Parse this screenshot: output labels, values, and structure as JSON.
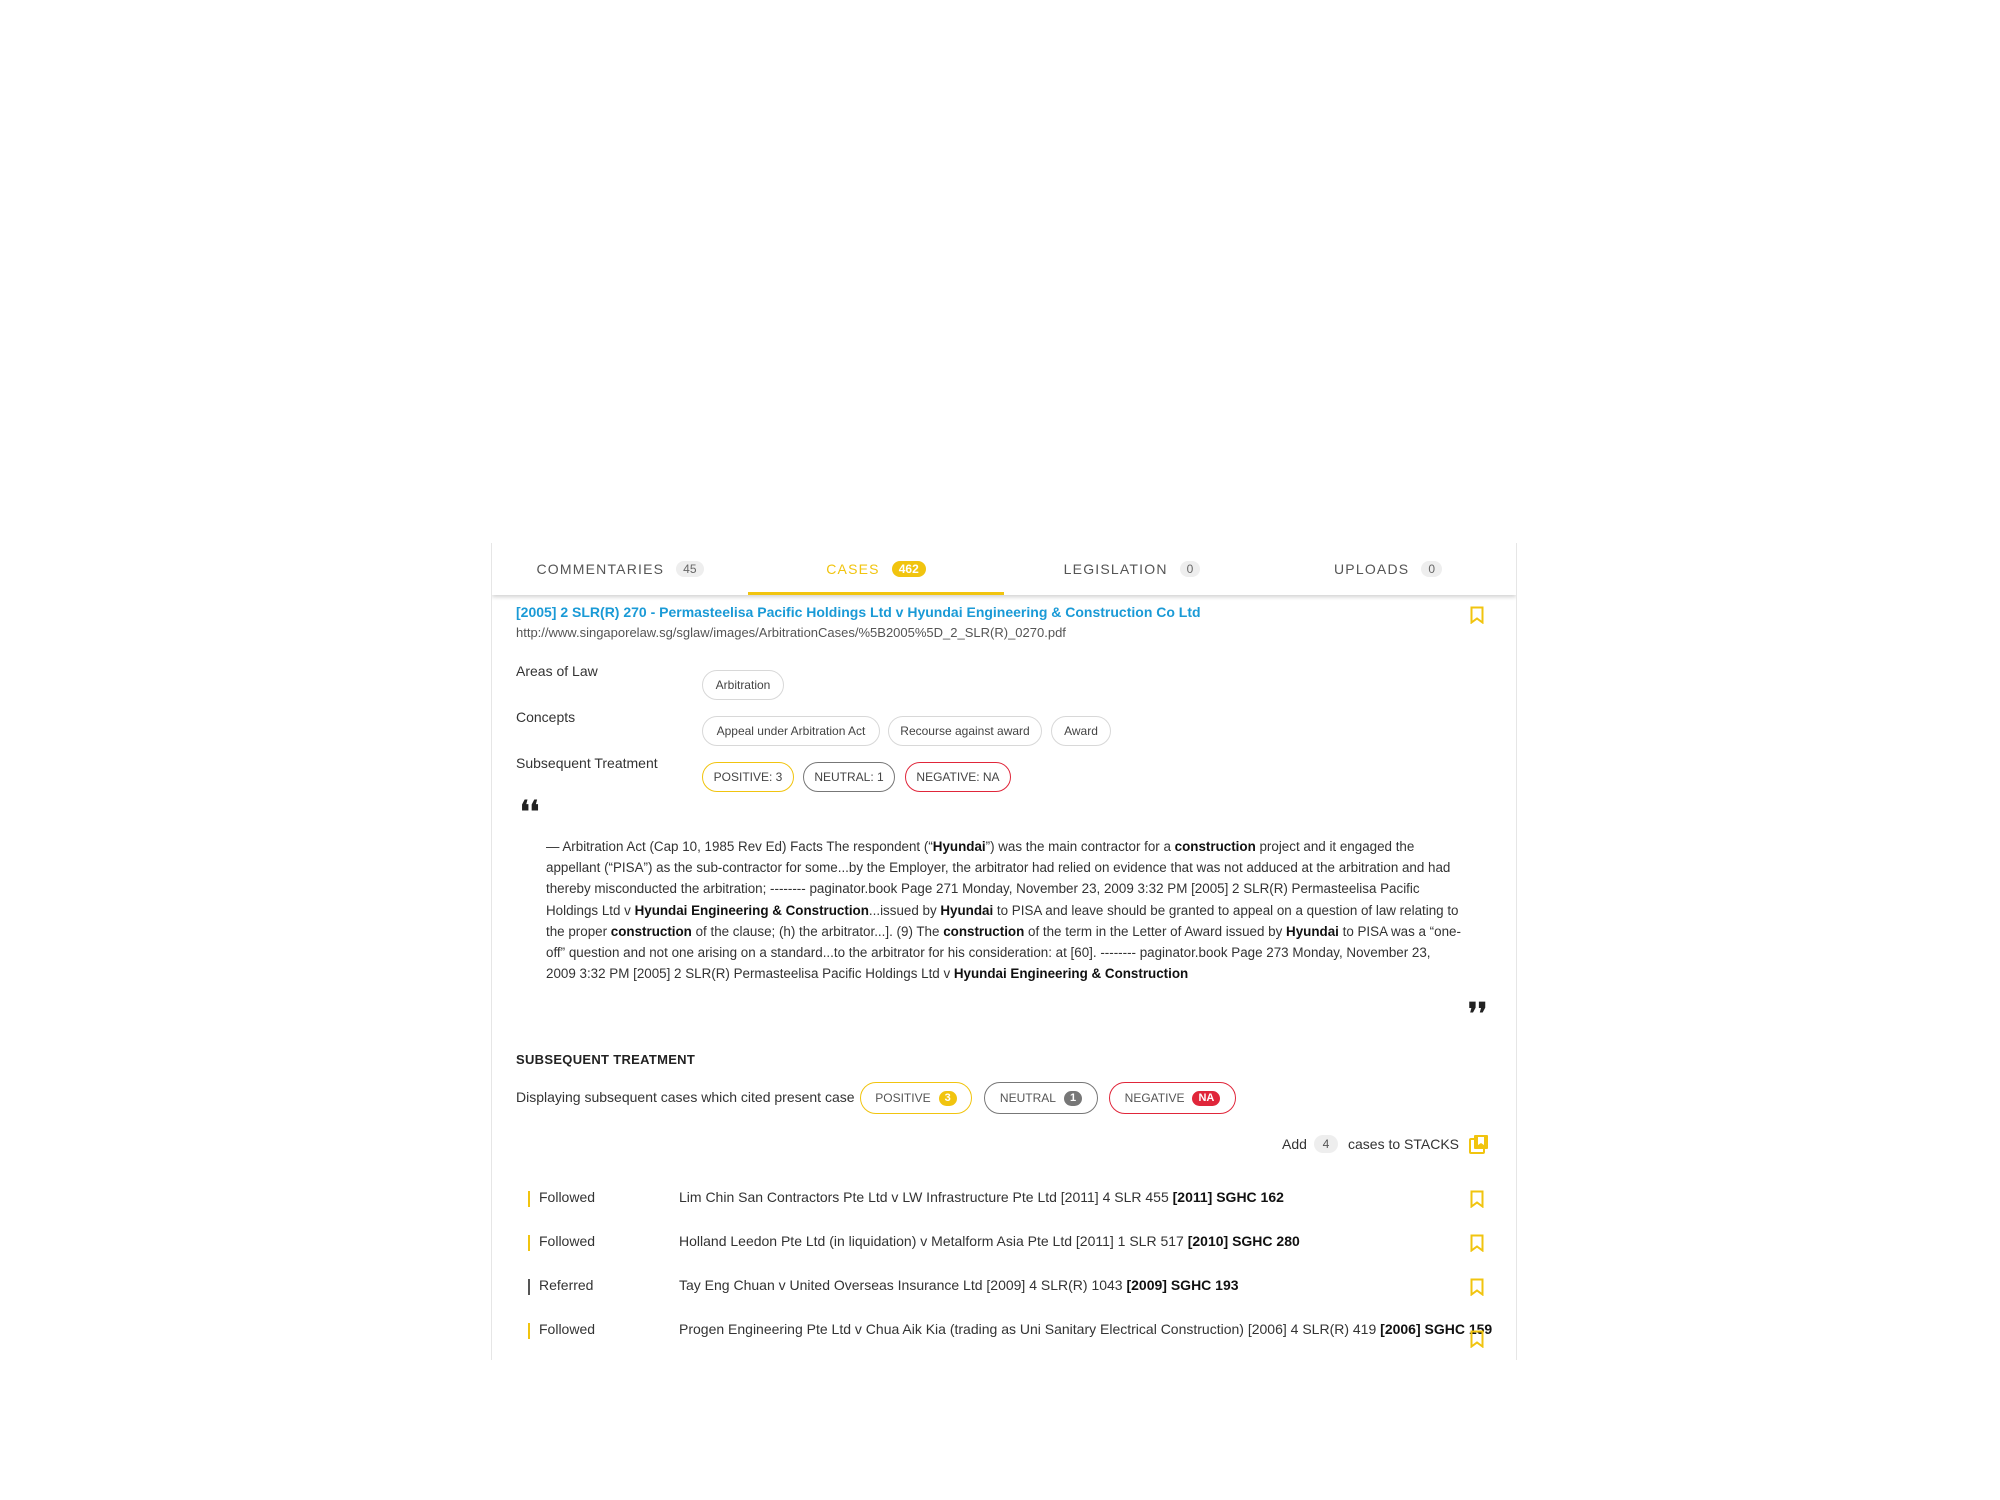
{
  "tabs": [
    {
      "label": "COMMENTARIES",
      "count": "45"
    },
    {
      "label": "CASES",
      "count": "462"
    },
    {
      "label": "LEGISLATION",
      "count": "0"
    },
    {
      "label": "UPLOADS",
      "count": "0"
    }
  ],
  "active_tab": "CASES",
  "case": {
    "title": "[2005] 2 SLR(R) 270 - Permasteelisa Pacific Holdings Ltd v Hyundai Engineering & Construction Co Ltd",
    "url": "http://www.singaporelaw.sg/sglaw/images/ArbitrationCases/%5B2005%5D_2_SLR(R)_0270.pdf"
  },
  "meta": {
    "areas_label": "Areas of Law",
    "areas": [
      "Arbitration"
    ],
    "concepts_label": "Concepts",
    "concepts": [
      "Appeal under Arbitration Act",
      "Recourse against award",
      "Award"
    ],
    "treatment_label": "Subsequent Treatment",
    "treatment_chips": {
      "positive": "POSITIVE: 3",
      "neutral": "NEUTRAL: 1",
      "negative": "NEGATIVE: NA"
    }
  },
  "quote": {
    "open": "❛❛",
    "close": "❜❜",
    "segments": [
      {
        "t": "— Arbitration Act (Cap 10, 1985 Rev Ed) Facts The respondent (“",
        "b": false
      },
      {
        "t": "Hyundai",
        "b": true
      },
      {
        "t": "”) was the main contractor for a ",
        "b": false
      },
      {
        "t": "construction",
        "b": true
      },
      {
        "t": " project and it engaged the appellant (“PISA”) as the sub-contractor for some...by the Employer, the arbitrator had relied on evidence that was not adduced at the arbitration and had thereby misconducted the arbitration; -------- paginator.book Page 271 Monday, November 23, 2009 3:32 PM [2005] 2 SLR(R) Permasteelisa Pacific Holdings Ltd v ",
        "b": false
      },
      {
        "t": "Hyundai Engineering & Construction",
        "b": true
      },
      {
        "t": "...issued by ",
        "b": false
      },
      {
        "t": "Hyundai",
        "b": true
      },
      {
        "t": " to PISA and leave should be granted to appeal on a question of law relating to the proper ",
        "b": false
      },
      {
        "t": "construction",
        "b": true
      },
      {
        "t": " of the clause; (h) the arbitrator...]. (9) The ",
        "b": false
      },
      {
        "t": "construction",
        "b": true
      },
      {
        "t": " of the term in the Letter of Award issued by ",
        "b": false
      },
      {
        "t": "Hyundai",
        "b": true
      },
      {
        "t": " to PISA was a “one-off” question and not one arising on a standard...to the arbitrator for his consideration: at [60]. -------- paginator.book Page 273 Monday, November 23, 2009 3:32 PM [2005] 2 SLR(R) Permasteelisa Pacific Holdings Ltd v ",
        "b": false
      },
      {
        "t": "Hyundai Engineering & Construction",
        "b": true
      }
    ]
  },
  "subsequent": {
    "title": "SUBSEQUENT TREATMENT",
    "display_text": "Displaying subsequent cases which cited present case",
    "filters": [
      {
        "label": "POSITIVE",
        "badge": "3",
        "color": "#f1c40f"
      },
      {
        "label": "NEUTRAL",
        "badge": "1",
        "color": "#777777"
      },
      {
        "label": "NEGATIVE",
        "badge": "NA",
        "color": "#e0263a"
      }
    ],
    "add_prefix": "Add",
    "add_count": "4",
    "add_suffix": "cases to STACKS",
    "rows": [
      {
        "treatment": "Followed",
        "bar_color": "#f1c40f",
        "case": "Lim Chin San Contractors Pte Ltd v LW Infrastructure Pte Ltd [2011] 4 SLR 455",
        "citation": "[2011] SGHC 162"
      },
      {
        "treatment": "Followed",
        "bar_color": "#f1c40f",
        "case": "Holland Leedon Pte Ltd (in liquidation) v Metalform Asia Pte Ltd [2011] 1 SLR 517",
        "citation": "[2010] SGHC 280"
      },
      {
        "treatment": "Referred",
        "bar_color": "#555555",
        "case": "Tay Eng Chuan v United Overseas Insurance Ltd [2009] 4 SLR(R) 1043",
        "citation": "[2009] SGHC 193"
      },
      {
        "treatment": "Followed",
        "bar_color": "#f1c40f",
        "case": "Progen Engineering Pte Ltd v Chua Aik Kia (trading as Uni Sanitary Electrical Construction) [2006] 4 SLR(R) 419",
        "citation": "[2006] SGHC 159"
      }
    ]
  },
  "colors": {
    "accent": "#f1c40f",
    "link": "#1a9ad6",
    "negative": "#e0263a",
    "neutral": "#777777"
  },
  "icons": {
    "bookmark": "bookmark-icon",
    "stack": "stack-icon",
    "quote": "quote-icon"
  }
}
